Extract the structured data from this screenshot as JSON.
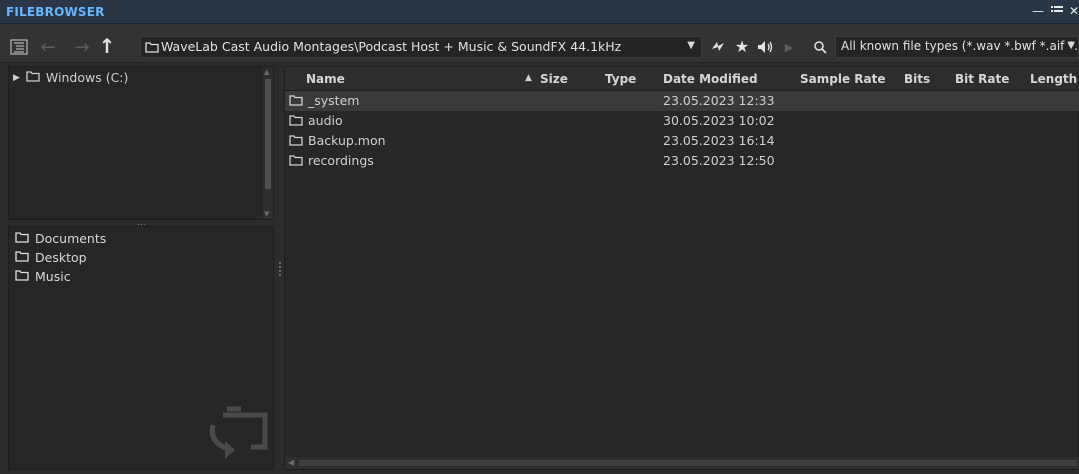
{
  "window": {
    "title": "FILEBROWSER"
  },
  "toolbar": {
    "path": "WaveLab Cast Audio Montages\\Podcast Host + Music & SoundFX 44.1kHz",
    "filter": "All known file types (*.wav *.bwf *.aif *."
  },
  "tree": {
    "drive_label": "Windows (C:)"
  },
  "favorites": [
    {
      "label": "Documents"
    },
    {
      "label": "Desktop"
    },
    {
      "label": "Music"
    }
  ],
  "columns": [
    "Name",
    "Size",
    "Type",
    "Date Modified",
    "Sample Rate",
    "Bits",
    "Bit Rate",
    "Length"
  ],
  "files": [
    {
      "name": "_system",
      "date": "23.05.2023 12:33",
      "selected": true
    },
    {
      "name": "audio",
      "date": "30.05.2023 10:02",
      "selected": false
    },
    {
      "name": "Backup.mon",
      "date": "23.05.2023 16:14",
      "selected": false
    },
    {
      "name": "recordings",
      "date": "23.05.2023 12:50",
      "selected": false
    }
  ],
  "icons": [
    "list-view-icon",
    "back-arrow-icon",
    "forward-arrow-icon",
    "up-arrow-icon",
    "folder-icon",
    "sync-icon",
    "star-icon",
    "speaker-icon",
    "play-icon",
    "search-icon",
    "minimize-icon",
    "menu-icon",
    "close-icon",
    "expand-triangle-icon",
    "recycle-folder-icon"
  ],
  "colors": {
    "title_accent": "#68b6ff",
    "background": "#2b2b2b",
    "selection": "#3a3a3a"
  }
}
